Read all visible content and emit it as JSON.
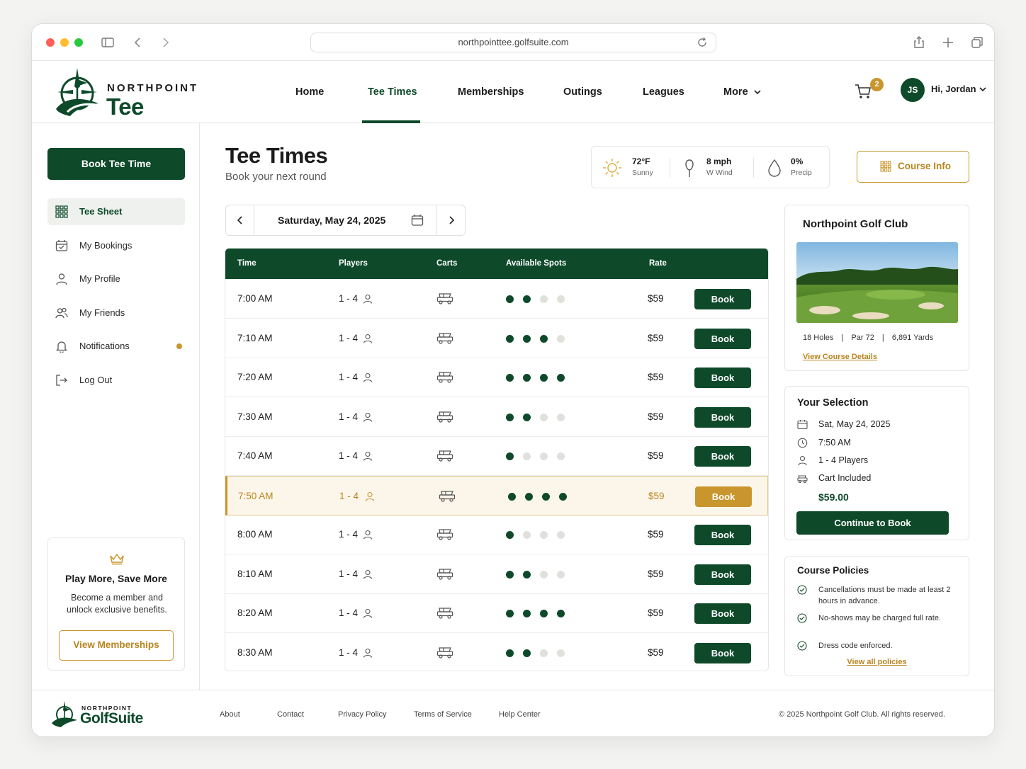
{
  "browser": {
    "url": "northpointtee.golfsuite.com",
    "colors": {
      "close": "#fe5f57",
      "minimize": "#febc2e",
      "maximize": "#28c840"
    }
  },
  "brand": {
    "subtitle": "NORTHPOINT",
    "name": "Tee",
    "primary_color": "#0e4a2a",
    "accent_color": "#c9962d"
  },
  "nav": {
    "items": [
      {
        "label": "Home",
        "active": false
      },
      {
        "label": "Tee Times",
        "active": true
      },
      {
        "label": "Memberships",
        "active": false
      },
      {
        "label": "Outings",
        "active": false
      },
      {
        "label": "Leagues",
        "active": false
      },
      {
        "label": "More",
        "active": false
      }
    ],
    "cart_count": "2",
    "user_initials": "JS",
    "user_greeting": "Hi, Jordan"
  },
  "sidebar": {
    "book_button": "Book Tee Time",
    "items": [
      {
        "label": "Tee Sheet",
        "icon": "grid-icon",
        "active": true
      },
      {
        "label": "My Bookings",
        "icon": "calendar-check-icon",
        "active": false
      },
      {
        "label": "My Profile",
        "icon": "user-icon",
        "active": false
      },
      {
        "label": "My Friends",
        "icon": "users-icon",
        "active": false
      },
      {
        "label": "Notifications",
        "icon": "bell-icon",
        "active": false,
        "has_dot": true
      },
      {
        "label": "Log Out",
        "icon": "logout-icon",
        "active": false
      }
    ],
    "promo": {
      "title": "Play More, Save More",
      "text": "Become a member and unlock exclusive benefits.",
      "button": "View Memberships"
    }
  },
  "main": {
    "title": "Tee Times",
    "subtitle": "Book your next round",
    "weather": {
      "temp": "72°F",
      "condition": "Sunny",
      "wind": "8 mph",
      "wind_dir": "W Wind",
      "precip": "0%",
      "precip_label": "Precip"
    },
    "course_info_button": "Course Info",
    "date": "Saturday, May 24, 2025",
    "table": {
      "headers": [
        "Time",
        "Players",
        "Carts",
        "Available Spots",
        "Rate"
      ],
      "book_label": "Book",
      "rows": [
        {
          "time": "7:00 AM",
          "players": "1 - 4",
          "spots": 2,
          "rate": "$59",
          "selected": false
        },
        {
          "time": "7:10 AM",
          "players": "1 - 4",
          "spots": 3,
          "rate": "$59",
          "selected": false
        },
        {
          "time": "7:20 AM",
          "players": "1 - 4",
          "spots": 4,
          "rate": "$59",
          "selected": false
        },
        {
          "time": "7:30 AM",
          "players": "1 - 4",
          "spots": 2,
          "rate": "$59",
          "selected": false
        },
        {
          "time": "7:40 AM",
          "players": "1 - 4",
          "spots": 1,
          "rate": "$59",
          "selected": false
        },
        {
          "time": "7:50 AM",
          "players": "1 - 4",
          "spots": 4,
          "rate": "$59",
          "selected": true
        },
        {
          "time": "8:00 AM",
          "players": "1 - 4",
          "spots": 1,
          "rate": "$59",
          "selected": false
        },
        {
          "time": "8:10 AM",
          "players": "1 - 4",
          "spots": 2,
          "rate": "$59",
          "selected": false
        },
        {
          "time": "8:20 AM",
          "players": "1 - 4",
          "spots": 4,
          "rate": "$59",
          "selected": false
        },
        {
          "time": "8:30 AM",
          "players": "1 - 4",
          "spots": 2,
          "rate": "$59",
          "selected": false
        }
      ]
    }
  },
  "club": {
    "name": "Northpoint Golf Club",
    "holes": "18 Holes",
    "par": "Par 72",
    "yards": "6,891 Yards",
    "link": "View Course Details"
  },
  "selection": {
    "title": "Your Selection",
    "date": "Sat, May 24, 2025",
    "time": "7:50 AM",
    "players": "1 - 4 Players",
    "cart": "Cart Included",
    "price": "$59.00",
    "button": "Continue to Book"
  },
  "policies": {
    "title": "Course Policies",
    "items": [
      "Cancellations must be made at least 2 hours in advance.",
      "No-shows may be charged full rate.",
      "Dress code enforced."
    ],
    "link": "View all policies"
  },
  "footer": {
    "brand_sub": "NORTHPOINT",
    "brand_main": "GolfSuite",
    "links": [
      "About",
      "Contact",
      "Privacy Policy",
      "Terms of Service",
      "Help Center"
    ],
    "copyright": "© 2025 Northpoint Golf Club. All rights reserved."
  }
}
